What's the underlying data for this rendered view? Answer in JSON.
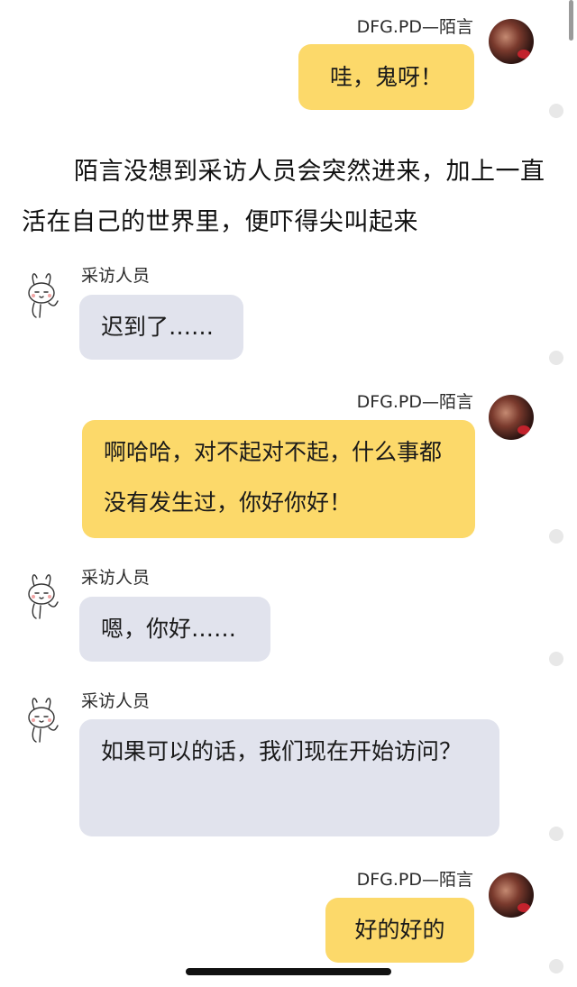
{
  "narration": "陌言没想到采访人员会突然进来，加上一直活在自己的世界里，便吓得尖叫起来",
  "messages": [
    {
      "sender": "DFG.PD—陌言",
      "text": "哇，鬼呀！"
    },
    {
      "sender": "采访人员",
      "text": "迟到了……"
    },
    {
      "sender": "DFG.PD—陌言",
      "text": "啊哈哈，对不起对不起，什么事都没有发生过，你好你好！"
    },
    {
      "sender": "采访人员",
      "text": "嗯，你好……"
    },
    {
      "sender": "采访人员",
      "text": "如果可以的话，我们现在开始访问？"
    },
    {
      "sender": "DFG.PD—陌言",
      "text": "好的好的"
    }
  ],
  "colors": {
    "right_bubble": "#fcd96a",
    "left_bubble": "#e1e3ed",
    "background": "#ffffff"
  },
  "icons": {
    "right_avatar": "photo-avatar-icon",
    "left_avatar": "rabbit-sticker-icon"
  }
}
